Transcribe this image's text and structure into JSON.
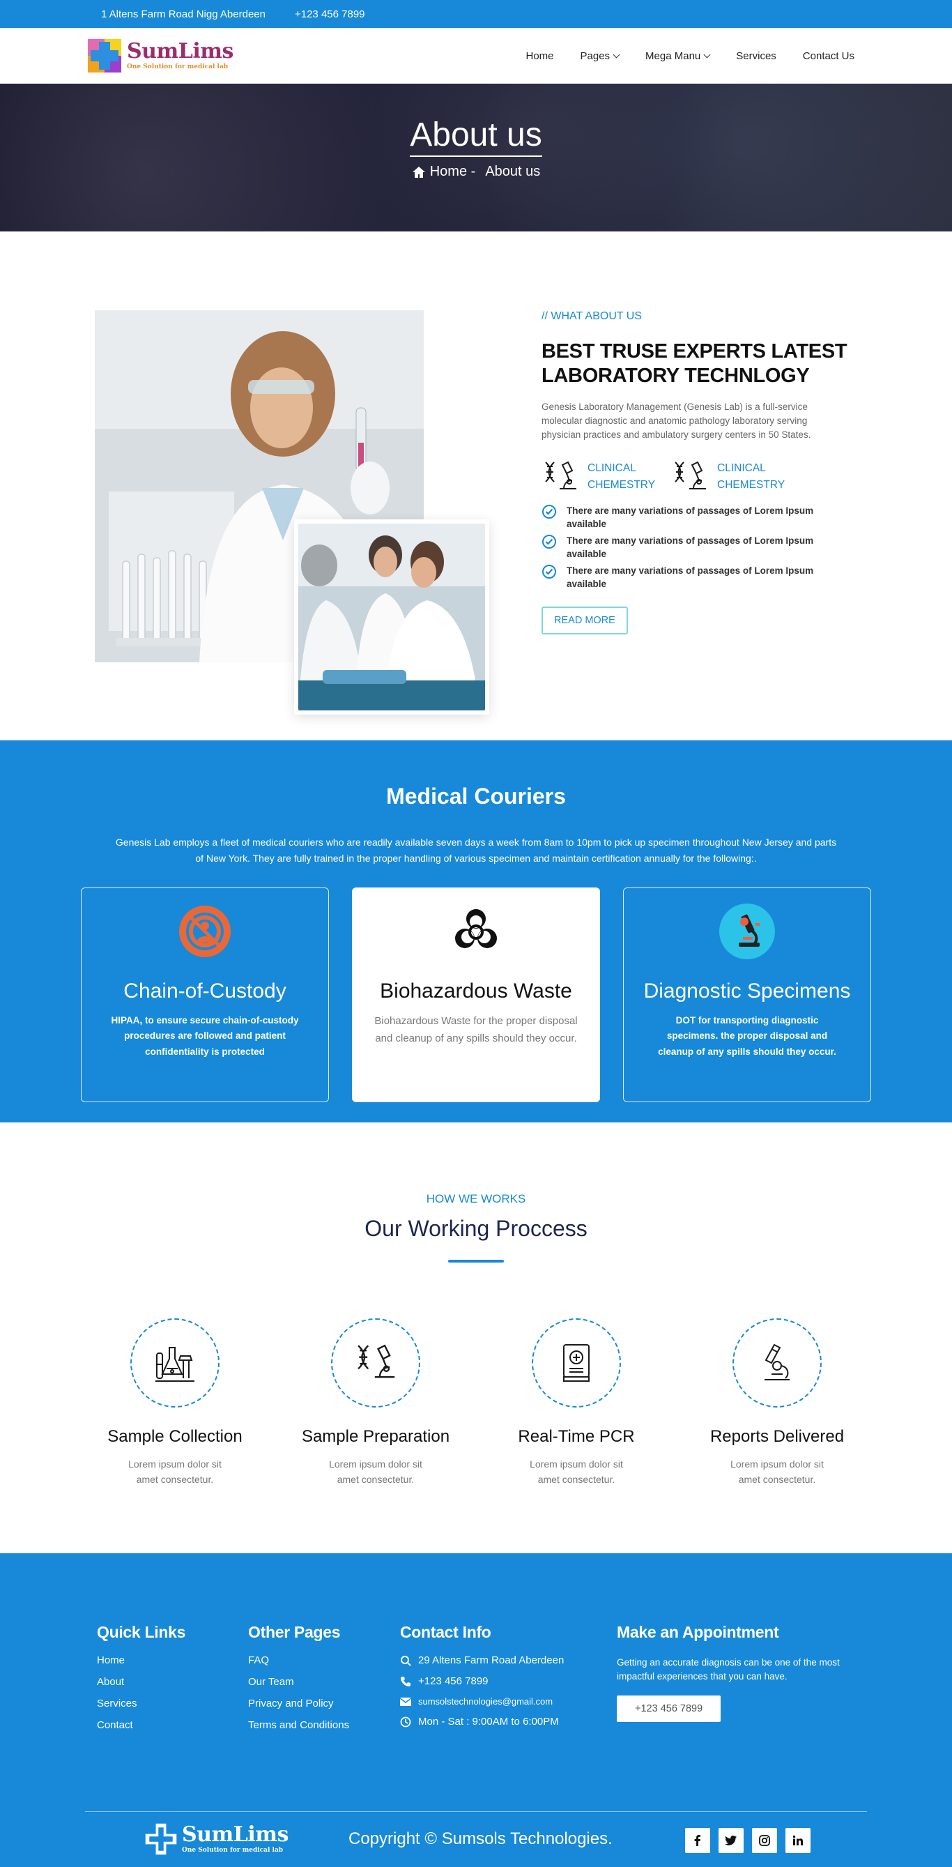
{
  "topbar": {
    "address": "1 Altens Farm Road Nigg Aberdeen",
    "phone": "+123 456 7899"
  },
  "brand": {
    "name": "SumLims",
    "tagline": "One Solution for medical lab"
  },
  "nav": {
    "items": [
      "Home",
      "Pages",
      "Mega Manu",
      "Services",
      "Contact Us"
    ]
  },
  "hero": {
    "title": "About us",
    "crumb_home": "Home -",
    "crumb_current": "About us"
  },
  "about": {
    "eyebrow": "// WHAT ABOUT US",
    "heading": "BEST TRUSE EXPERTS LATEST LABORATORY TECHNLOGY",
    "paragraph": "Genesis Laboratory Management (Genesis Lab) is a full-service molecular diagnostic and anatomic pathology laboratory serving physician practices and ambulatory surgery centers in 50 States.",
    "features": [
      "CLINICAL CHEMESTRY",
      "CLINICAL CHEMESTRY"
    ],
    "checks": [
      "There are many variations of passages of Lorem Ipsum available",
      "There are many variations of passages of Lorem Ipsum available",
      "There are many variations of passages of Lorem Ipsum available"
    ],
    "button": "READ MORE"
  },
  "couriers": {
    "title": "Medical Couriers",
    "paragraph": "Genesis Lab employs a fleet of medical couriers who are readily available seven days a week from 8am to 10pm to pick up specimen throughout New Jersey and parts of New York. They are fully trained in the proper handling of various specimen and maintain certification annually for the following:.",
    "cards": [
      {
        "title": "Chain-of-Custody",
        "desc": "HIPAA, to ensure secure chain-of-custody procedures are followed and patient confidentiality is protected"
      },
      {
        "title": "Biohazardous Waste",
        "desc": "Biohazardous Waste for the proper disposal and cleanup of any spills should they occur."
      },
      {
        "title": "Diagnostic Specimens",
        "desc": "DOT for transporting diagnostic specimens. the proper disposal and cleanup of any spills should they occur."
      }
    ]
  },
  "process": {
    "eyebrow": "HOW WE WORKS",
    "title": "Our Working Proccess",
    "steps": [
      {
        "title": "Sample Collection",
        "desc": "Lorem ipsum dolor sit amet consectetur."
      },
      {
        "title": "Sample Preparation",
        "desc": "Lorem ipsum dolor sit amet consectetur."
      },
      {
        "title": "Real-Time PCR",
        "desc": "Lorem ipsum dolor sit amet consectetur."
      },
      {
        "title": "Reports Delivered",
        "desc": "Lorem ipsum dolor sit amet consectetur."
      }
    ]
  },
  "footer": {
    "quick_title": "Quick Links",
    "quick_links": [
      "Home",
      "About",
      "Services",
      "Contact"
    ],
    "other_title": "Other Pages",
    "other_links": [
      "FAQ",
      "Our Team",
      "Privacy and Policy",
      "Terms and Conditions"
    ],
    "contact_title": "Contact Info",
    "contact": {
      "address": "29 Altens Farm Road Aberdeen",
      "phone": "+123 456 7899",
      "email": "sumsolstechnologies@gmail.com",
      "hours": "Mon - Sat : 9:00AM to 6:00PM"
    },
    "appt_title": "Make an Appointment",
    "appt_text": "Getting an accurate diagnosis can be one of the most impactful experiences that you can have.",
    "appt_button": "+123 456 7899",
    "copyright": "Copyright © Sumsols Technologies.",
    "socials": [
      "facebook-icon",
      "twitter-icon",
      "instagram-icon",
      "linkedin-icon"
    ]
  },
  "colors": {
    "primary": "#1789d8",
    "accent_teal": "#7fd6e0",
    "heading_dark": "#1c2453"
  }
}
